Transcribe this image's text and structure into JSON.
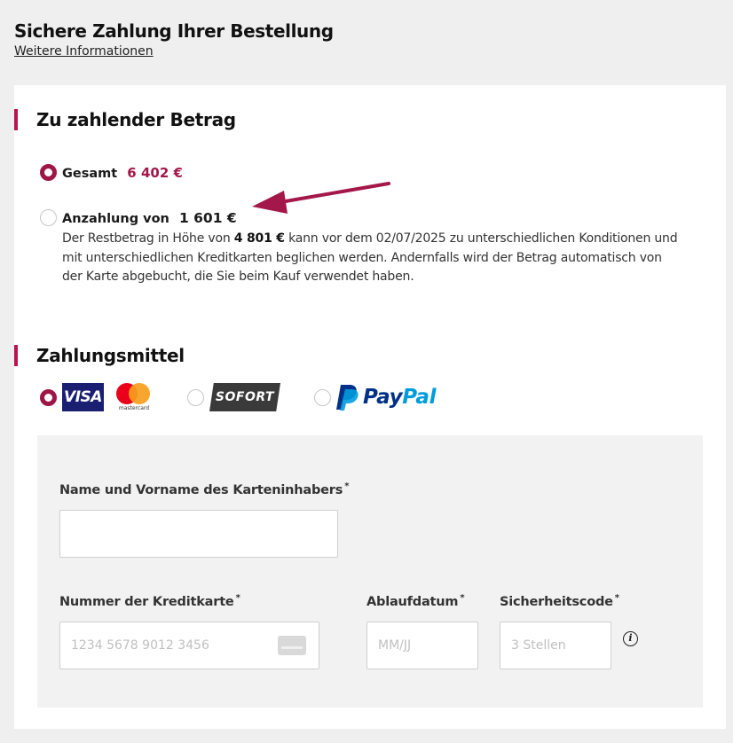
{
  "header": {
    "title": "Sichere Zahlung Ihrer Bestellung",
    "more_info": "Weitere Informationen"
  },
  "amount_section": {
    "title": "Zu zahlender Betrag",
    "options": [
      {
        "label": "Gesamt",
        "amount": "6 402 €",
        "selected": true
      },
      {
        "label": "Anzahlung von",
        "amount": "1 601 €",
        "selected": false,
        "desc_1": "Der Restbetrag in Höhe von ",
        "desc_bold": "4 801 €",
        "desc_2": " kann vor dem 02/07/2025 zu unterschiedlichen Konditionen und mit unterschiedlichen Kreditkarten beglichen werden. Andernfalls wird der Betrag automatisch von der Karte abgebucht, die Sie beim Kauf verwendet haben."
      }
    ],
    "arrow_color": "#a3174a"
  },
  "payment_section": {
    "title": "Zahlungsmittel",
    "methods": [
      {
        "id": "card",
        "logos": [
          "VISA",
          "mastercard"
        ],
        "selected": true
      },
      {
        "id": "sofort",
        "logo": "SOFORT",
        "selected": false
      },
      {
        "id": "paypal",
        "logo_pay": "Pay",
        "logo_pal": "Pal",
        "selected": false
      }
    ]
  },
  "form": {
    "cardholder_label": "Name und Vorname des Karteninhabers",
    "card_number_label": "Nummer der Kreditkarte",
    "card_number_placeholder": "1234 5678 9012 3456",
    "expiry_label": "Ablaufdatum",
    "expiry_placeholder": "MM/JJ",
    "cvc_label": "Sicherheitscode",
    "cvc_placeholder": "3 Stellen",
    "required_mark": "*",
    "info_icon": "i"
  },
  "colors": {
    "accent": "#b81550",
    "radio_selected": "#9e1646",
    "amount_red": "#a3174a",
    "visa": "#1a1f71",
    "paypal_dark": "#003087",
    "paypal_light": "#009cde"
  }
}
